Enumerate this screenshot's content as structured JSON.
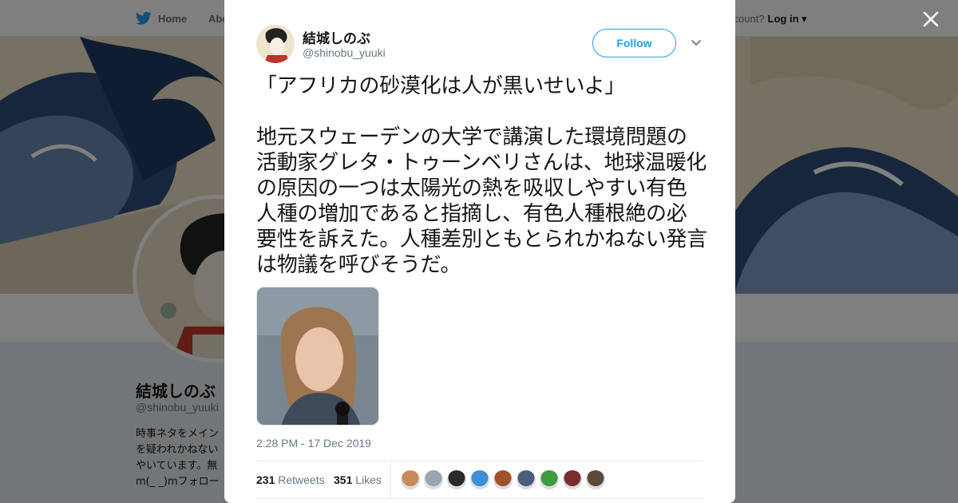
{
  "nav": {
    "home_label": "Home",
    "about_label": "Abo",
    "account_text": "ccount?",
    "login_label": "Log in"
  },
  "profile": {
    "name": "結城しのぶ",
    "handle": "@shinobu_yuuki",
    "bio": "時事ネタをメイン\nを疑われかねない\nやいています。無\nm(_ _)mフォロー"
  },
  "tweet": {
    "author_name": "結城しのぶ",
    "author_handle": "@shinobu_yuuki",
    "follow_label": "Follow",
    "text_lines": [
      "「アフリカの砂漠化は人が黒いせいよ」",
      "地元スウェーデンの大学で講演した環境問題の活動家グレタ・トゥーンベリさんは、地球温暖化の原因の一つは太陽光の熱を吸収しやすい有色人種の増加であると指摘し、有色人種根絶の必要性を訴えた。人種差別ともとられかねない発言は物議を呼びそうだ。"
    ],
    "timestamp": "2:28 PM - 17 Dec 2019",
    "retweets_count": "231",
    "retweets_label": "Retweets",
    "likes_count": "351",
    "likes_label": "Likes",
    "liker_colors": [
      "#c98a5a",
      "#9aa5b1",
      "#2b2b2b",
      "#3d8fd6",
      "#a0522d",
      "#4a5d7a",
      "#3f9b3f",
      "#7b2d2d",
      "#5a4a3a"
    ]
  },
  "colors": {
    "accent": "#1da1f2",
    "overlay": "rgba(0,0,0,0.5)"
  }
}
